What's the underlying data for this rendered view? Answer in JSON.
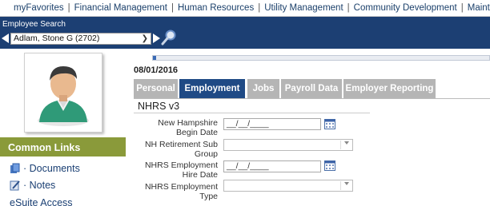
{
  "topnav": {
    "items": [
      "myFavorites",
      "Financial Management",
      "Human Resources",
      "Utility Management",
      "Community Development",
      "Maintenance"
    ]
  },
  "search": {
    "label": "Employee Search",
    "employee": "Adlam, Stone G (2702)"
  },
  "sidebar": {
    "common_links_title": "Common Links",
    "links": [
      "· Documents",
      "· Notes"
    ],
    "esuite": "eSuite Access"
  },
  "main": {
    "effective_date": "08/01/2016",
    "progress_fraction": 0.01,
    "tabs": [
      {
        "label": "Personal",
        "active": false
      },
      {
        "label": "Employment",
        "active": true
      },
      {
        "label": "Jobs",
        "active": false
      },
      {
        "label": "Payroll Data",
        "active": false
      },
      {
        "label": "Employer Reporting",
        "active": false
      }
    ],
    "section_title": "NHRS v3",
    "fields": [
      {
        "label": "New Hampshire Begin Date",
        "type": "date",
        "value": "__/__/____"
      },
      {
        "label": "NH Retirement Sub Group",
        "type": "select",
        "value": ""
      },
      {
        "label": "NHRS Employment Hire Date",
        "type": "date",
        "value": "__/__/____"
      },
      {
        "label": "NHRS Employment Type",
        "type": "select",
        "value": ""
      }
    ]
  },
  "colors": {
    "header_blue": "#1c3f73",
    "tab_active": "#1f4a85",
    "tab_inactive": "#b5b5b5",
    "common_links_bg": "#8a9a3a",
    "link_blue": "#1a3f73"
  }
}
